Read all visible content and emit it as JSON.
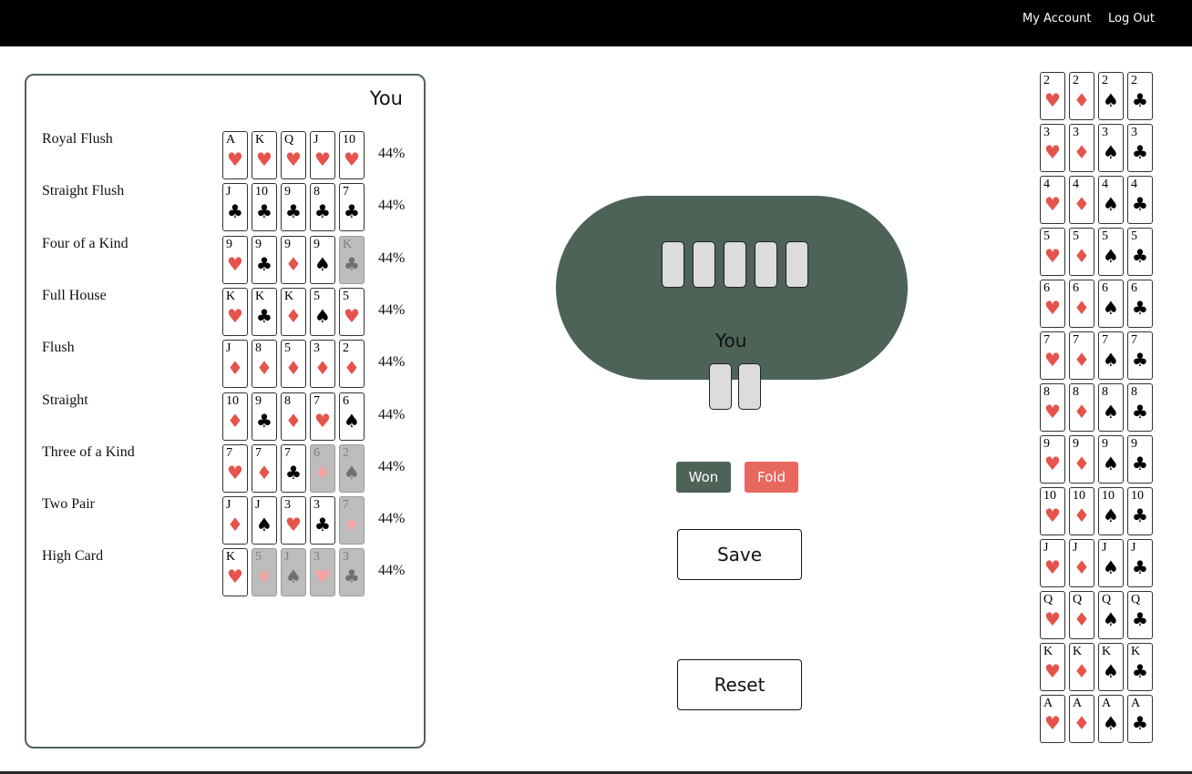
{
  "nav": {
    "my_account": "My Account",
    "log_out": "Log Out"
  },
  "panel": {
    "title": "You",
    "hands": [
      {
        "name": "Royal Flush",
        "pct": "44%",
        "cards": [
          {
            "rank": "A",
            "suit": "♥",
            "color": "red",
            "dim": false
          },
          {
            "rank": "K",
            "suit": "♥",
            "color": "red",
            "dim": false
          },
          {
            "rank": "Q",
            "suit": "♥",
            "color": "red",
            "dim": false
          },
          {
            "rank": "J",
            "suit": "♥",
            "color": "red",
            "dim": false
          },
          {
            "rank": "10",
            "suit": "♥",
            "color": "red",
            "dim": false
          }
        ]
      },
      {
        "name": "Straight Flush",
        "pct": "44%",
        "cards": [
          {
            "rank": "J",
            "suit": "♣",
            "color": "black",
            "dim": false
          },
          {
            "rank": "10",
            "suit": "♣",
            "color": "black",
            "dim": false
          },
          {
            "rank": "9",
            "suit": "♣",
            "color": "black",
            "dim": false
          },
          {
            "rank": "8",
            "suit": "♣",
            "color": "black",
            "dim": false
          },
          {
            "rank": "7",
            "suit": "♣",
            "color": "black",
            "dim": false
          }
        ]
      },
      {
        "name": "Four of a Kind",
        "pct": "44%",
        "cards": [
          {
            "rank": "9",
            "suit": "♥",
            "color": "red",
            "dim": false
          },
          {
            "rank": "9",
            "suit": "♣",
            "color": "black",
            "dim": false
          },
          {
            "rank": "9",
            "suit": "♦",
            "color": "red",
            "dim": false
          },
          {
            "rank": "9",
            "suit": "♠",
            "color": "black",
            "dim": false
          },
          {
            "rank": "K",
            "suit": "♣",
            "color": "black",
            "dim": true
          }
        ]
      },
      {
        "name": "Full House",
        "pct": "44%",
        "cards": [
          {
            "rank": "K",
            "suit": "♥",
            "color": "red",
            "dim": false
          },
          {
            "rank": "K",
            "suit": "♣",
            "color": "black",
            "dim": false
          },
          {
            "rank": "K",
            "suit": "♦",
            "color": "red",
            "dim": false
          },
          {
            "rank": "5",
            "suit": "♠",
            "color": "black",
            "dim": false
          },
          {
            "rank": "5",
            "suit": "♥",
            "color": "red",
            "dim": false
          }
        ]
      },
      {
        "name": "Flush",
        "pct": "44%",
        "cards": [
          {
            "rank": "J",
            "suit": "♦",
            "color": "red",
            "dim": false
          },
          {
            "rank": "8",
            "suit": "♦",
            "color": "red",
            "dim": false
          },
          {
            "rank": "5",
            "suit": "♦",
            "color": "red",
            "dim": false
          },
          {
            "rank": "3",
            "suit": "♦",
            "color": "red",
            "dim": false
          },
          {
            "rank": "2",
            "suit": "♦",
            "color": "red",
            "dim": false
          }
        ]
      },
      {
        "name": "Straight",
        "pct": "44%",
        "cards": [
          {
            "rank": "10",
            "suit": "♦",
            "color": "red",
            "dim": false
          },
          {
            "rank": "9",
            "suit": "♣",
            "color": "black",
            "dim": false
          },
          {
            "rank": "8",
            "suit": "♦",
            "color": "red",
            "dim": false
          },
          {
            "rank": "7",
            "suit": "♥",
            "color": "red",
            "dim": false
          },
          {
            "rank": "6",
            "suit": "♠",
            "color": "black",
            "dim": false
          }
        ]
      },
      {
        "name": "Three of a Kind",
        "pct": "44%",
        "cards": [
          {
            "rank": "7",
            "suit": "♥",
            "color": "red",
            "dim": false
          },
          {
            "rank": "7",
            "suit": "♦",
            "color": "red",
            "dim": false
          },
          {
            "rank": "7",
            "suit": "♣",
            "color": "black",
            "dim": false
          },
          {
            "rank": "6",
            "suit": "♦",
            "color": "red",
            "dim": true
          },
          {
            "rank": "2",
            "suit": "♠",
            "color": "black",
            "dim": true
          }
        ]
      },
      {
        "name": "Two Pair",
        "pct": "44%",
        "cards": [
          {
            "rank": "J",
            "suit": "♦",
            "color": "red",
            "dim": false
          },
          {
            "rank": "J",
            "suit": "♠",
            "color": "black",
            "dim": false
          },
          {
            "rank": "3",
            "suit": "♥",
            "color": "red",
            "dim": false
          },
          {
            "rank": "3",
            "suit": "♣",
            "color": "black",
            "dim": false
          },
          {
            "rank": "7",
            "suit": "♦",
            "color": "red",
            "dim": true
          }
        ]
      },
      {
        "name": "High Card",
        "pct": "44%",
        "cards": [
          {
            "rank": "K",
            "suit": "♥",
            "color": "red",
            "dim": false
          },
          {
            "rank": "5",
            "suit": "♦",
            "color": "red",
            "dim": true
          },
          {
            "rank": "J",
            "suit": "♠",
            "color": "black",
            "dim": true
          },
          {
            "rank": "3",
            "suit": "♥",
            "color": "red",
            "dim": true
          },
          {
            "rank": "3",
            "suit": "♣",
            "color": "black",
            "dim": true
          }
        ]
      }
    ]
  },
  "table": {
    "player_label": "You",
    "community_slots": 5,
    "hole_slots": 2
  },
  "buttons": {
    "won": "Won",
    "fold": "Fold",
    "save": "Save",
    "reset": "Reset"
  },
  "colors": {
    "table": "#4d6358",
    "won": "#4d6358",
    "fold": "#e8675f",
    "red_suit": "#e5534b"
  },
  "deck": {
    "ranks": [
      "2",
      "3",
      "4",
      "5",
      "6",
      "7",
      "8",
      "9",
      "10",
      "J",
      "Q",
      "K",
      "A"
    ],
    "suits": [
      {
        "symbol": "♥",
        "color": "red",
        "name": "hearts"
      },
      {
        "symbol": "♦",
        "color": "red",
        "name": "diamonds"
      },
      {
        "symbol": "♠",
        "color": "black",
        "name": "spades"
      },
      {
        "symbol": "♣",
        "color": "black",
        "name": "clubs"
      }
    ]
  }
}
